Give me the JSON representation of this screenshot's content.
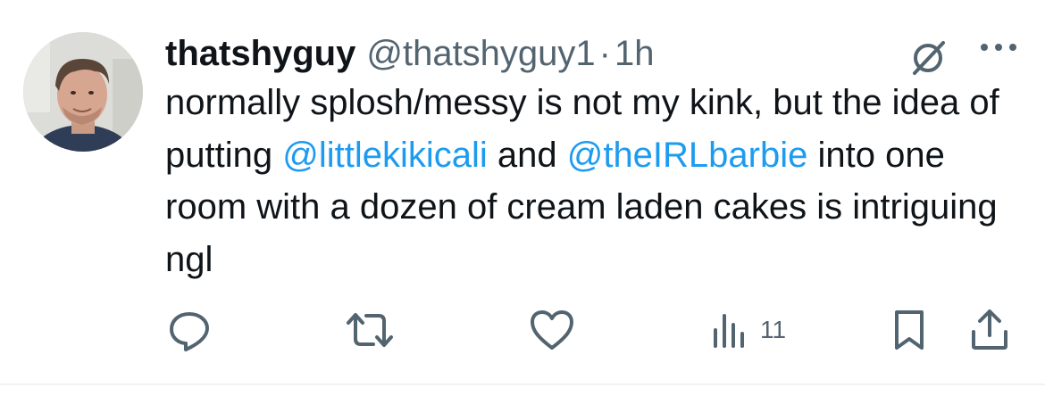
{
  "tweet": {
    "author": {
      "display_name": "thatshyguy",
      "handle": "@thatshyguy1",
      "separator": "·",
      "time": "1h",
      "avatar": "profile-photo"
    },
    "text_segments": [
      {
        "type": "text",
        "value": "normally splosh/messy is not my kink, but the idea of putting "
      },
      {
        "type": "mention",
        "value": "@littlekikicali"
      },
      {
        "type": "text",
        "value": " and "
      },
      {
        "type": "mention",
        "value": "@theIRLbarbie"
      },
      {
        "type": "text",
        "value": " into one room with a dozen of cream laden cakes is intriguing ngl"
      }
    ],
    "header_icons": {
      "grok": "grok-icon",
      "more": "more-horizontal-icon"
    },
    "actions": {
      "reply": {
        "icon": "reply-icon"
      },
      "retweet": {
        "icon": "retweet-icon"
      },
      "like": {
        "icon": "heart-icon"
      },
      "views": {
        "icon": "views-bar-chart-icon",
        "count": "11"
      },
      "bookmark": {
        "icon": "bookmark-icon"
      },
      "share": {
        "icon": "share-icon"
      }
    }
  },
  "colors": {
    "text": "#0f1419",
    "secondary": "#536471",
    "accent": "#1d9bf0",
    "border": "#eff3f4",
    "background": "#ffffff"
  }
}
